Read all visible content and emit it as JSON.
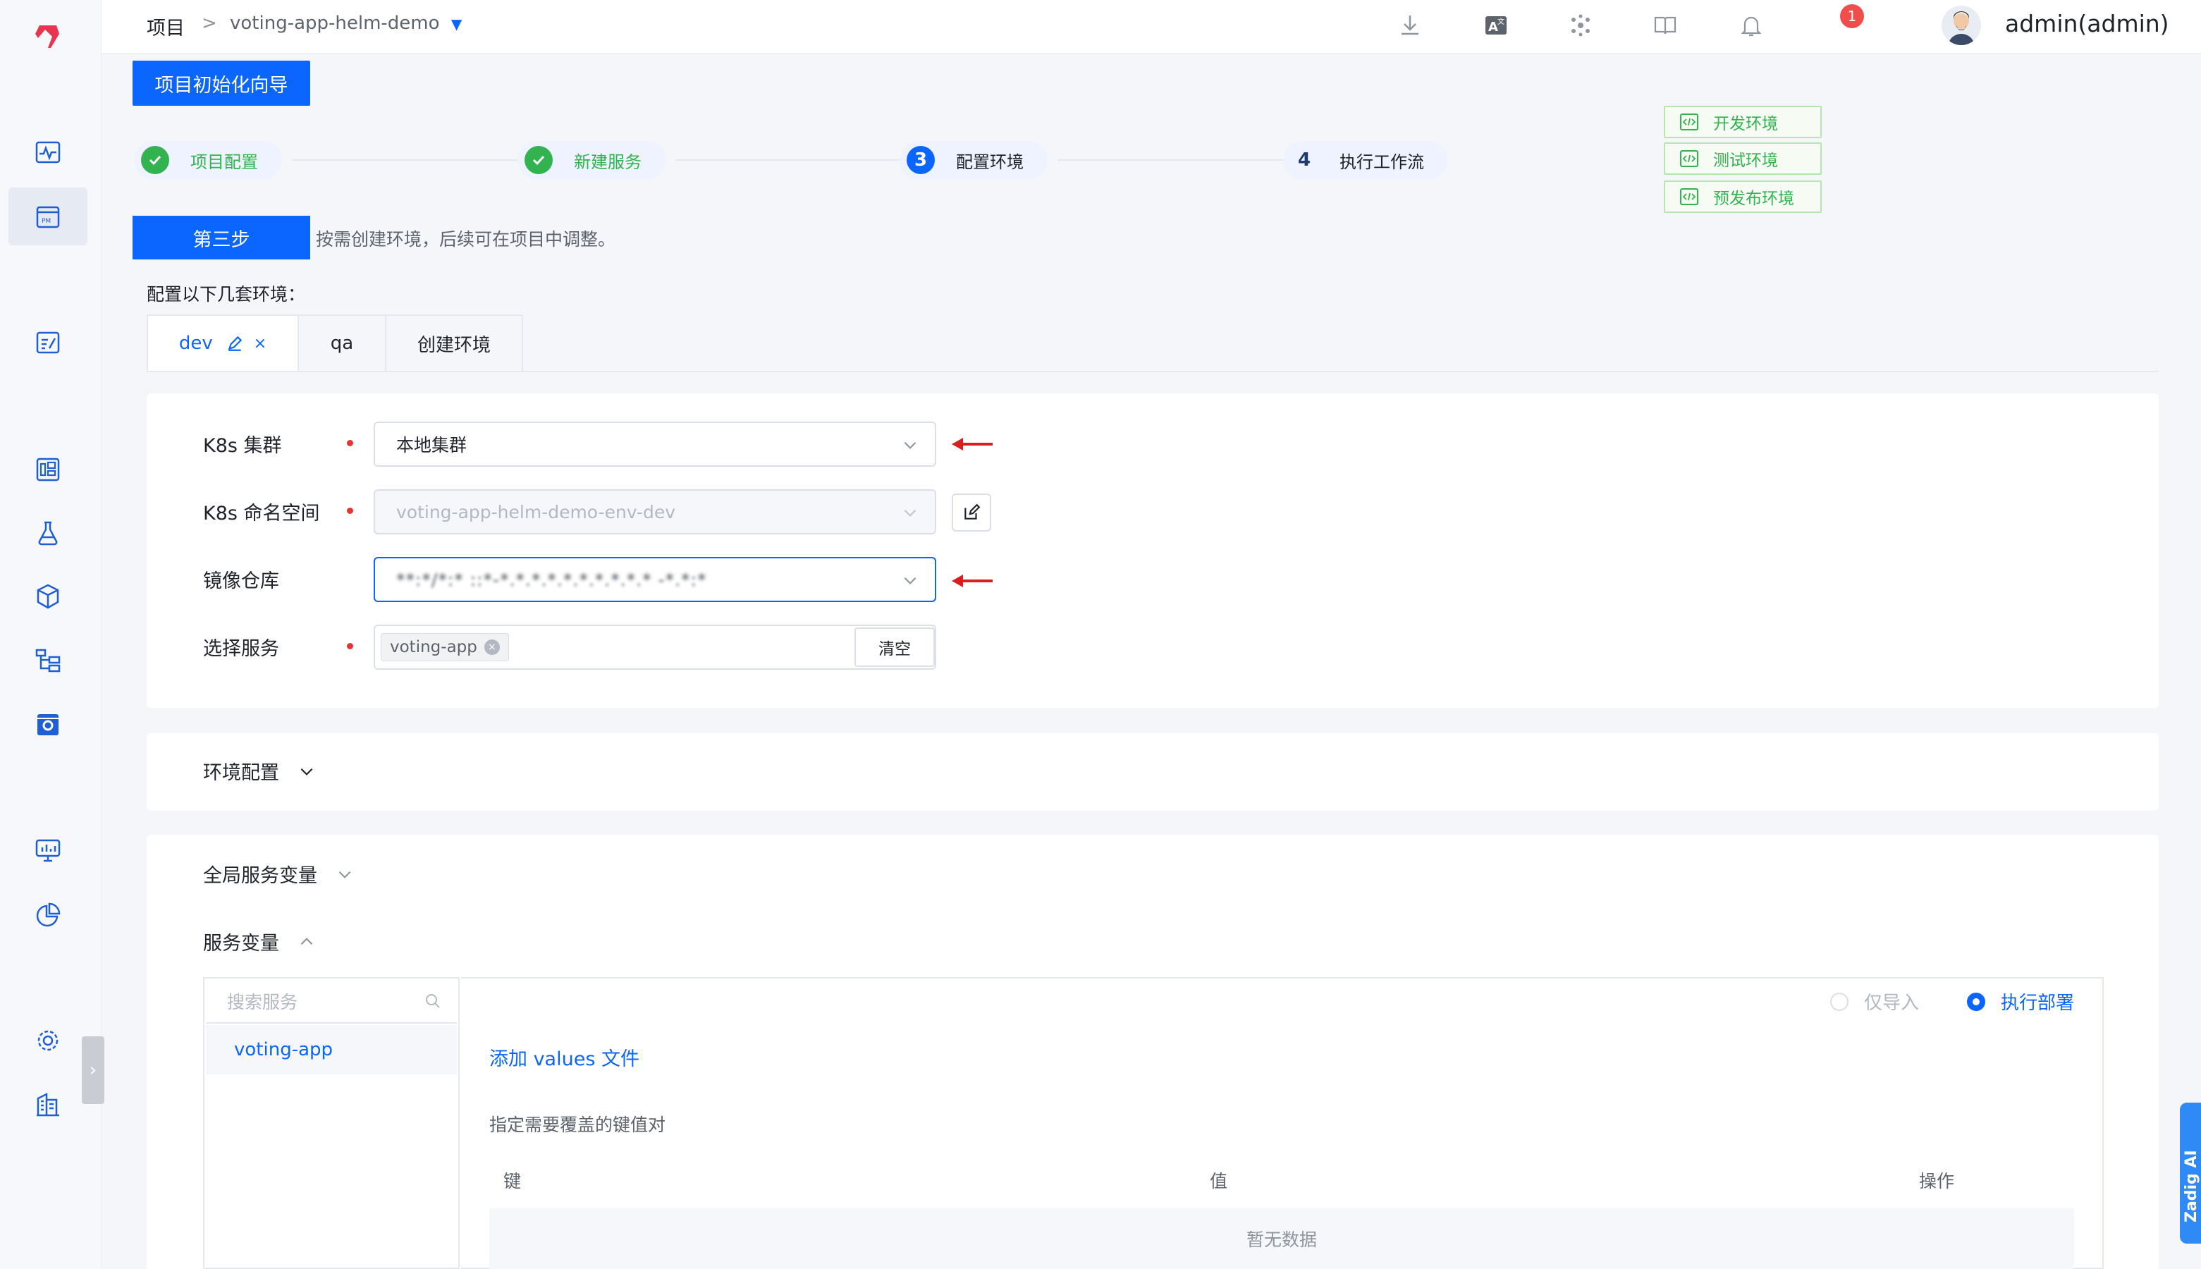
{
  "header": {
    "breadcrumb_root": "项目",
    "breadcrumb_sep": ">",
    "project_name": "voting-app-helm-demo",
    "notification_count": "1",
    "username": "admin(admin)"
  },
  "wizard": {
    "title_button": "项目初始化向导",
    "steps": [
      {
        "index": "1",
        "label": "项目配置",
        "status": "done"
      },
      {
        "index": "2",
        "label": "新建服务",
        "status": "done"
      },
      {
        "index": "3",
        "label": "配置环境",
        "status": "active"
      },
      {
        "index": "4",
        "label": "执行工作流",
        "status": "pending"
      }
    ],
    "env_tags": [
      "开发环境",
      "测试环境",
      "预发布环境"
    ],
    "step_tag": "第三步",
    "step_desc": "按需创建环境，后续可在项目中调整。",
    "config_title": "配置以下几套环境："
  },
  "tabs": {
    "items": [
      "dev",
      "qa",
      "创建环境"
    ],
    "active": "dev"
  },
  "form": {
    "k8s_cluster_label": "K8s 集群",
    "k8s_cluster_value": "本地集群",
    "namespace_label": "K8s 命名空间",
    "namespace_value": "voting-app-helm-demo-env-dev",
    "registry_label": "镜像仓库",
    "registry_value": "**:*/*:* ::*-*.*.*.*.*.*.*.*.*.* -*.*:*",
    "service_label": "选择服务",
    "service_chip": "voting-app",
    "clear_button": "清空"
  },
  "sections": {
    "env_config": "环境配置",
    "global_vars": "全局服务变量",
    "service_vars": "服务变量"
  },
  "service_vars": {
    "search_placeholder": "搜索服务",
    "services": [
      "voting-app"
    ],
    "radio_import_only": "仅导入",
    "radio_deploy": "执行部署",
    "add_values": "添加 values 文件",
    "hint": "指定需要覆盖的键值对",
    "col_key": "键",
    "col_value": "值",
    "col_action": "操作",
    "empty": "暂无数据"
  },
  "side_tab": "Zadig AI",
  "colors": {
    "primary": "#0a66ff",
    "success": "#32b350",
    "danger": "#e53434"
  }
}
